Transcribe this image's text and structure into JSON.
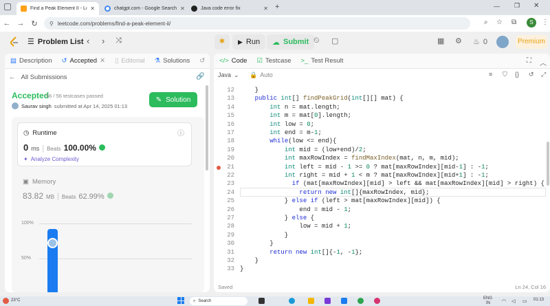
{
  "browser": {
    "tabs": [
      {
        "title": "Find a Peak Element II - LeetCo",
        "active": true,
        "color": "#ffa116"
      },
      {
        "title": "chatgpt.com - Google Search",
        "active": false,
        "color": "#4285f4"
      },
      {
        "title": "Java code error fix",
        "active": false,
        "color": "#222222"
      }
    ],
    "url": "leetcode.com/problems/find-a-peak-element-ii/",
    "profile_initial": "S"
  },
  "header": {
    "problem_list": "Problem List",
    "run": "Run",
    "submit": "Submit",
    "streak": "0",
    "premium": "Premium"
  },
  "left_tabs": [
    "Description",
    "Accepted",
    "Editorial",
    "Solutions"
  ],
  "submission": {
    "back": "All Submissions",
    "status": "Accepted",
    "passed": "56 / 56 testcases passed",
    "user": "Saurav singh",
    "submitted": "submitted at Apr 14, 2025 01:13",
    "solution_btn": "Solution",
    "runtime_label": "Runtime",
    "runtime_value": "0",
    "runtime_unit": "ms",
    "beats_label": "Beats",
    "runtime_beats": "100.00%",
    "analyze": "Analyze Complexity",
    "memory_label": "Memory",
    "memory_value": "83.82",
    "memory_unit": "MB",
    "memory_beats": "62.99%",
    "chart_ticks": [
      "100%",
      "50%"
    ]
  },
  "chart_data": {
    "type": "bar",
    "ylim": [
      0,
      100
    ],
    "values": [
      100
    ]
  },
  "right_tabs": [
    "Code",
    "Testcase",
    "Test Result"
  ],
  "editor": {
    "lang": "Java",
    "mode": "Auto",
    "saved": "Saved",
    "cursor": "Ln 24, Col 16"
  },
  "code_lines": [
    {
      "n": "12",
      "t": "    }"
    },
    {
      "n": "13",
      "t": "    public int[] findPeakGrid(int[][] mat) {"
    },
    {
      "n": "14",
      "t": "        int n = mat.length;"
    },
    {
      "n": "15",
      "t": "        int m = mat[0].length;"
    },
    {
      "n": "16",
      "t": "        int low = 0;"
    },
    {
      "n": "17",
      "t": "        int end = m-1;"
    },
    {
      "n": "18",
      "t": "        while(low <= end){"
    },
    {
      "n": "19",
      "t": "            int mid = (low+end)/2;"
    },
    {
      "n": "20",
      "t": "            int maxRowIndex = findMaxIndex(mat, n, m, mid);"
    },
    {
      "n": "21",
      "t": "            int left = mid - 1 >= 0 ? mat[maxRowIndex][mid-1] : -1;"
    },
    {
      "n": "22",
      "t": "            int right = mid + 1 < m ? mat[maxRowIndex][mid+1] : -1;"
    },
    {
      "n": "23",
      "t": "              if (mat[maxRowIndex][mid] > left && mat[maxRowIndex][mid] > right) {"
    },
    {
      "n": "24",
      "t": "                return new int[]{maxRowIndex, mid};"
    },
    {
      "n": "25",
      "t": "            } else if (left > mat[maxRowIndex][mid]) {"
    },
    {
      "n": "26",
      "t": "                end = mid - 1;"
    },
    {
      "n": "27",
      "t": "            } else {"
    },
    {
      "n": "28",
      "t": "                low = mid + 1;"
    },
    {
      "n": "29",
      "t": "            }"
    },
    {
      "n": "30",
      "t": "        }"
    },
    {
      "n": "31",
      "t": "        return new int[]{-1, -1};"
    },
    {
      "n": "32",
      "t": "    }"
    },
    {
      "n": "33",
      "t": "}"
    }
  ],
  "taskbar": {
    "weather": "23°C",
    "search": "Search",
    "lang": "ENG",
    "region": "IN",
    "time": "01:13"
  }
}
